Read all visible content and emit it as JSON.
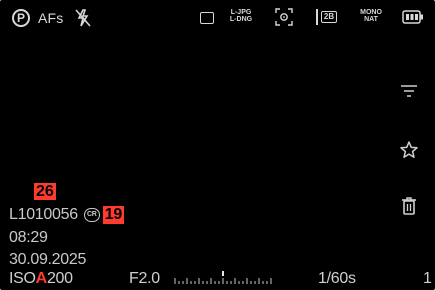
{
  "top_bar": {
    "mode": "P",
    "af_mode": "AFs",
    "flash_icon": "flash-off-icon",
    "drive_icon": "single-shot-icon",
    "file_format": [
      "L-JPG",
      "L-DNG"
    ],
    "metering_icon": "spot-metering-icon",
    "memory_card_icon": "sd-card-icon",
    "card_label": "2B",
    "film_style": [
      "MONO",
      "NAT"
    ],
    "battery_icon": "battery-icon"
  },
  "side_icons": [
    "filter-icon",
    "star-icon",
    "trash-icon"
  ],
  "image_info": {
    "count": "26",
    "file_name": "L1010056",
    "cr_label": "CR",
    "cr_count": "19",
    "time": "08:29",
    "date": "30.09.2025"
  },
  "bottom_bar": {
    "iso_prefix": "ISO",
    "iso_auto": "A",
    "iso_value": "200",
    "aperture": "F2.0",
    "shutter": "1/60s",
    "index": "1"
  },
  "colors": {
    "background": "#000000",
    "accent_red": "#ff3b30",
    "text": "#cfcfcf"
  }
}
